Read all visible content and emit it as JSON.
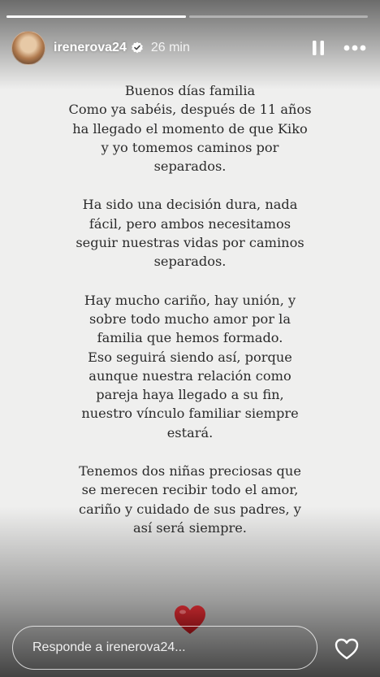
{
  "progress": {
    "segments": 2,
    "active_index": 0,
    "active_fraction": 1.0
  },
  "header": {
    "username": "irenerova24",
    "verified": true,
    "time_ago": "26 min",
    "pause_icon": "pause-icon",
    "more_icon": "more-horizontal-icon"
  },
  "message": {
    "paragraphs": [
      "Buenos días familia\nComo ya sabéis, después de 11 años\nha llegado el momento de que Kiko\ny yo tomemos caminos por\nseparados.",
      "Ha sido una decisión dura, nada\nfácil, pero ambos necesitamos\nseguir nuestras vidas por caminos\nseparados.",
      "Hay mucho cariño, hay unión, y\nsobre todo mucho amor por la\nfamilia que hemos formado.\nEso seguirá siendo así, porque\naunque nuestra relación  como\npareja haya llegado a su fin,\nnuestro vínculo familiar siempre\nestará.",
      "Tenemos dos niñas preciosas que\nse merecen recibir todo el amor,\ncariño y cuidado de sus padres, y\nasí será siempre."
    ]
  },
  "sticker": {
    "icon": "red-heart-icon",
    "color": "#8e1419"
  },
  "footer": {
    "reply_placeholder": "Responde a irenerova24...",
    "like_icon": "heart-outline-icon"
  }
}
